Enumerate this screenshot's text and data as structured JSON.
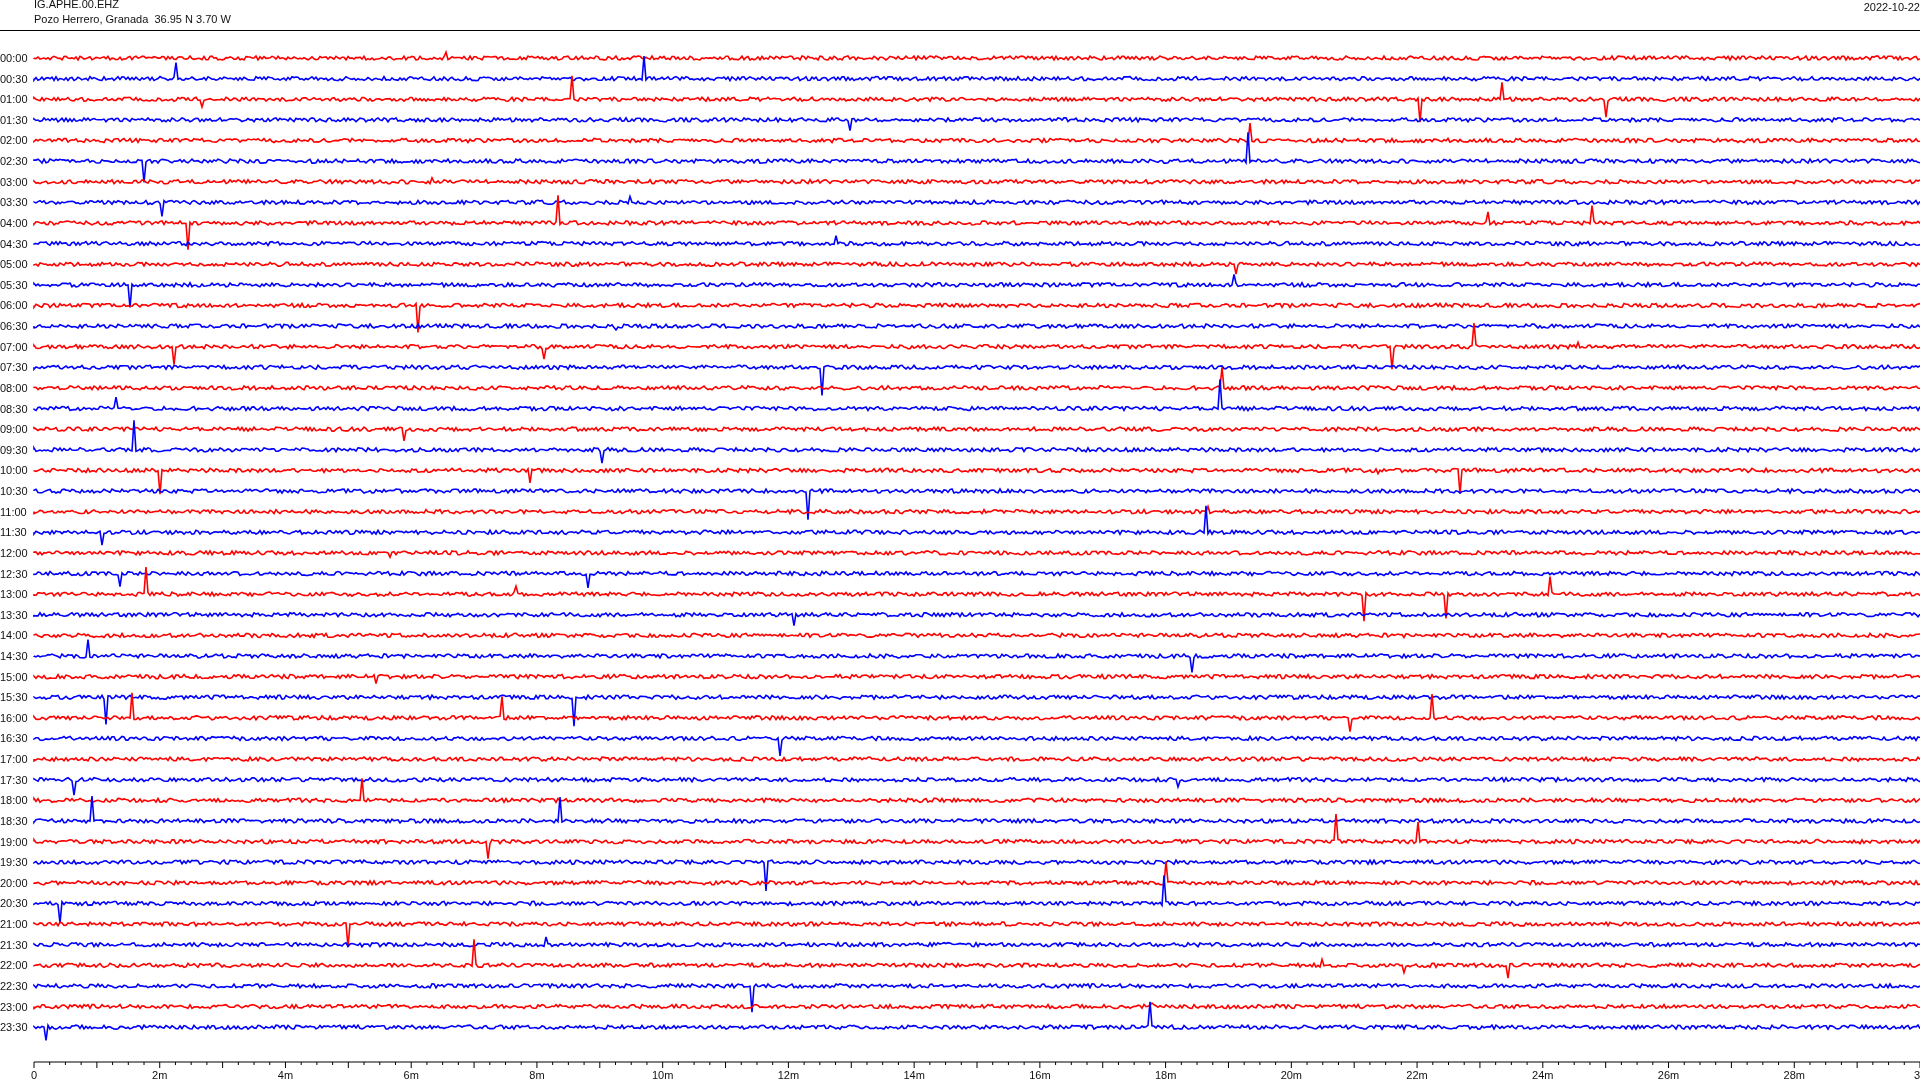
{
  "header": {
    "station": "IG.APHE.00.EHZ",
    "location": "Pozo Herrero, Granada  36.95 N 3.70 W",
    "date": "2022-10-22"
  },
  "rows": [
    {
      "time": "00:00",
      "color": "#ff0000"
    },
    {
      "time": "00:30",
      "color": "#0000ff"
    },
    {
      "time": "01:00",
      "color": "#ff0000"
    },
    {
      "time": "01:30",
      "color": "#0000ff"
    },
    {
      "time": "02:00",
      "color": "#ff0000"
    },
    {
      "time": "02:30",
      "color": "#0000ff"
    },
    {
      "time": "03:00",
      "color": "#ff0000"
    },
    {
      "time": "03:30",
      "color": "#0000ff"
    },
    {
      "time": "04:00",
      "color": "#ff0000"
    },
    {
      "time": "04:30",
      "color": "#0000ff"
    },
    {
      "time": "05:00",
      "color": "#ff0000"
    },
    {
      "time": "05:30",
      "color": "#0000ff"
    },
    {
      "time": "06:00",
      "color": "#ff0000"
    },
    {
      "time": "06:30",
      "color": "#0000ff"
    },
    {
      "time": "07:00",
      "color": "#ff0000"
    },
    {
      "time": "07:30",
      "color": "#0000ff"
    },
    {
      "time": "08:00",
      "color": "#ff0000"
    },
    {
      "time": "08:30",
      "color": "#0000ff"
    },
    {
      "time": "09:00",
      "color": "#ff0000"
    },
    {
      "time": "09:30",
      "color": "#0000ff"
    },
    {
      "time": "10:00",
      "color": "#ff0000"
    },
    {
      "time": "10:30",
      "color": "#0000ff"
    },
    {
      "time": "11:00",
      "color": "#ff0000"
    },
    {
      "time": "11:30",
      "color": "#0000ff"
    },
    {
      "time": "12:00",
      "color": "#ff0000"
    },
    {
      "time": "12:30",
      "color": "#0000ff"
    },
    {
      "time": "13:00",
      "color": "#ff0000"
    },
    {
      "time": "13:30",
      "color": "#0000ff"
    },
    {
      "time": "14:00",
      "color": "#ff0000"
    },
    {
      "time": "14:30",
      "color": "#0000ff"
    },
    {
      "time": "15:00",
      "color": "#ff0000"
    },
    {
      "time": "15:30",
      "color": "#0000ff"
    },
    {
      "time": "16:00",
      "color": "#ff0000"
    },
    {
      "time": "16:30",
      "color": "#0000ff"
    },
    {
      "time": "17:00",
      "color": "#ff0000"
    },
    {
      "time": "17:30",
      "color": "#0000ff"
    },
    {
      "time": "18:00",
      "color": "#ff0000"
    },
    {
      "time": "18:30",
      "color": "#0000ff"
    },
    {
      "time": "19:00",
      "color": "#ff0000"
    },
    {
      "time": "19:30",
      "color": "#0000ff"
    },
    {
      "time": "20:00",
      "color": "#ff0000"
    },
    {
      "time": "20:30",
      "color": "#0000ff"
    },
    {
      "time": "21:00",
      "color": "#ff0000"
    },
    {
      "time": "21:30",
      "color": "#0000ff"
    },
    {
      "time": "22:00",
      "color": "#ff0000"
    },
    {
      "time": "22:30",
      "color": "#0000ff"
    },
    {
      "time": "23:00",
      "color": "#ff0000"
    },
    {
      "time": "23:30",
      "color": "#0000ff"
    }
  ],
  "x_axis": {
    "tick_labels": [
      "0",
      "2m",
      "4m",
      "6m",
      "8m",
      "10m",
      "12m",
      "14m",
      "16m",
      "18m",
      "20m",
      "22m",
      "24m",
      "26m",
      "28m",
      "3"
    ]
  }
}
